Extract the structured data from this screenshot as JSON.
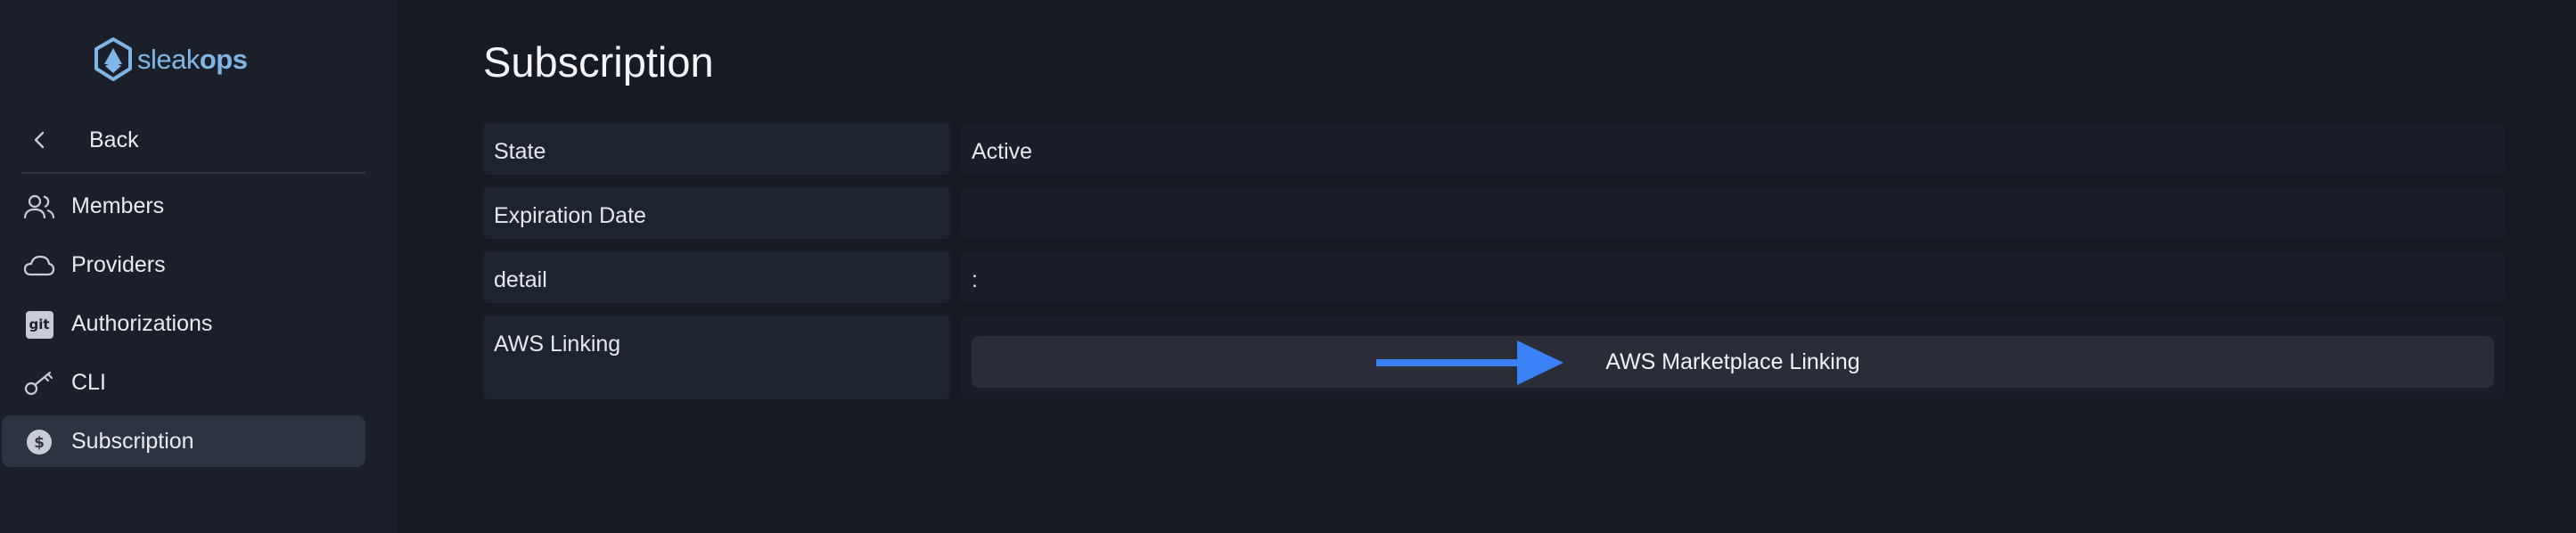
{
  "brand": {
    "name_light": "sleak",
    "name_bold": "ops"
  },
  "sidebar": {
    "back_label": "Back",
    "items": [
      {
        "label": "Members",
        "icon": "users-icon"
      },
      {
        "label": "Providers",
        "icon": "cloud-icon"
      },
      {
        "label": "Authorizations",
        "icon": "git-icon",
        "badge": "git"
      },
      {
        "label": "CLI",
        "icon": "key-icon"
      },
      {
        "label": "Subscription",
        "icon": "dollar-icon",
        "active": true
      }
    ]
  },
  "main": {
    "title": "Subscription",
    "rows": [
      {
        "label": "State",
        "value": "Active"
      },
      {
        "label": "Expiration Date",
        "value": ""
      },
      {
        "label": "detail",
        "value": ":"
      },
      {
        "label": "AWS Linking"
      }
    ],
    "aws_button_label": "AWS Marketplace Linking"
  },
  "colors": {
    "background": "#171a23",
    "sidebar": "#1b1f2a",
    "active_item": "#2c3342",
    "accent_arrow": "#3b82f6",
    "logo": "#7fb6e8"
  }
}
